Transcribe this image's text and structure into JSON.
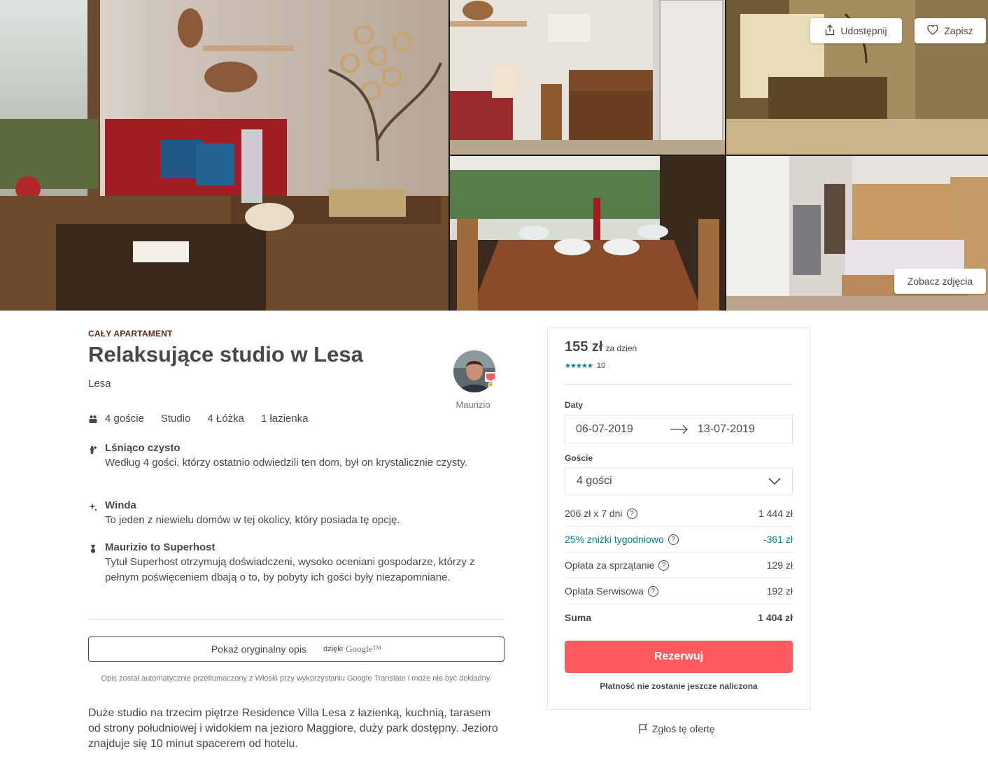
{
  "gallery": {
    "share_label": "Udostępnij",
    "save_label": "Zapisz",
    "view_photos_label": "Zobacz zdjęcia"
  },
  "listing": {
    "type_kicker": "CAŁY APARTAMENT",
    "title": "Relaksujące studio w Lesa",
    "city": "Lesa",
    "host_name": "Maurizio",
    "facts": [
      "4 goście",
      "Studio",
      "4 Łóżka",
      "1 łazienka"
    ],
    "highlights": [
      {
        "icon": "sparkle-clean-icon",
        "title": "Lśniąco czysto",
        "desc": "Według 4 gości, którzy ostatnio odwiedzili ten dom, był on krystalicznie czysty."
      },
      {
        "icon": "elevator-sparkle-icon",
        "title": "Winda",
        "desc": "To jeden z niewielu domów w tej okolicy, który posiada tę opcję."
      },
      {
        "icon": "superhost-medal-icon",
        "title": "Maurizio to Superhost",
        "desc": "Tytuł Superhost otrzymują doświadczeni, wysoko oceniani gospodarze, którzy z pełnym poświęceniem dbają o to, by pobyty ich gości były niezapomniane."
      }
    ],
    "translate_button": "Pokaż oryginalny opis",
    "translate_by": "dzięki",
    "translate_brand": "Google™",
    "translate_note": "Opis został automatycznie przetłumaczony z Włoski przy wykorzystaniu Google Translate i może nie być dokładny.",
    "description": "Duże studio na trzecim piętrze Residence Villa Lesa z łazienką, kuchnią, tarasem od strony południowej i widokiem na jezioro Maggiore, duży park dostępny. Jezioro znajduje się 10 minut spacerem od hotelu."
  },
  "booking": {
    "price": "155 zł",
    "price_unit": "za dzień",
    "rating_count": "10",
    "rating_stars": 4.5,
    "dates_label": "Daty",
    "check_in": "06-07-2019",
    "check_out": "13-07-2019",
    "guests_label": "Goście",
    "guests_value": "4 gości",
    "lines": [
      {
        "label": "206 zł x 7 dni",
        "value": "1 444 zł"
      },
      {
        "label": "25% zniżki tygodniowo",
        "value": "-361 zł"
      },
      {
        "label": "Opłata za sprzątanie",
        "value": "129 zł"
      },
      {
        "label": "Opłata Serwisowa",
        "value": "192 zł"
      },
      {
        "label": "Suma",
        "value": "1 404 zł"
      }
    ],
    "reserve_label": "Rezerwuj",
    "no_charge_note": "Płatność nie zostanie jeszcze naliczona",
    "report_label": "Zgłoś tę ofertę"
  },
  "colors": {
    "accent": "#ff5a5f",
    "teal": "#008489",
    "text": "#484848",
    "kicker": "#5f2a1d"
  }
}
